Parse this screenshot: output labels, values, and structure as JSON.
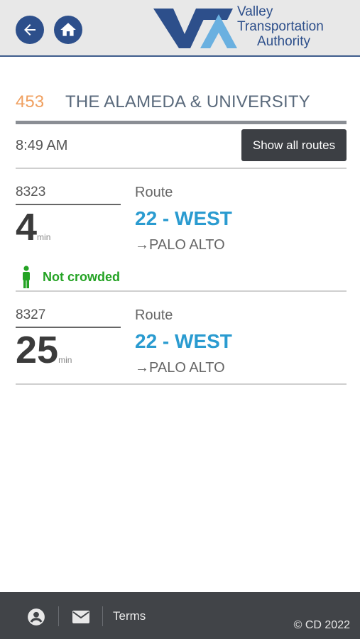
{
  "header": {
    "back_icon": "arrow-left-icon",
    "home_icon": "home-icon",
    "logo_lines": [
      "Valley",
      "Transportation",
      "Authority"
    ],
    "brand_color": "#2d4f8b",
    "accent_color": "#6ab0e0"
  },
  "stop": {
    "id": "453",
    "name": "THE ALAMEDA & UNIVERSITY"
  },
  "current_time": "8:49 AM",
  "show_all_routes_label": "Show all routes",
  "arrivals": [
    {
      "bus_number": "8323",
      "minutes": "4",
      "min_label": "min",
      "route_label": "Route",
      "route_name": "22 - WEST",
      "destination": "→PALO ALTO",
      "crowding": "Not crowded"
    },
    {
      "bus_number": "8327",
      "minutes": "25",
      "min_label": "min",
      "route_label": "Route",
      "route_name": "22 - WEST",
      "destination": "→PALO ALTO"
    }
  ],
  "footer": {
    "account_icon": "account-circle-icon",
    "mail_icon": "mail-icon",
    "terms_label": "Terms",
    "copyright": "© CD 2022"
  }
}
